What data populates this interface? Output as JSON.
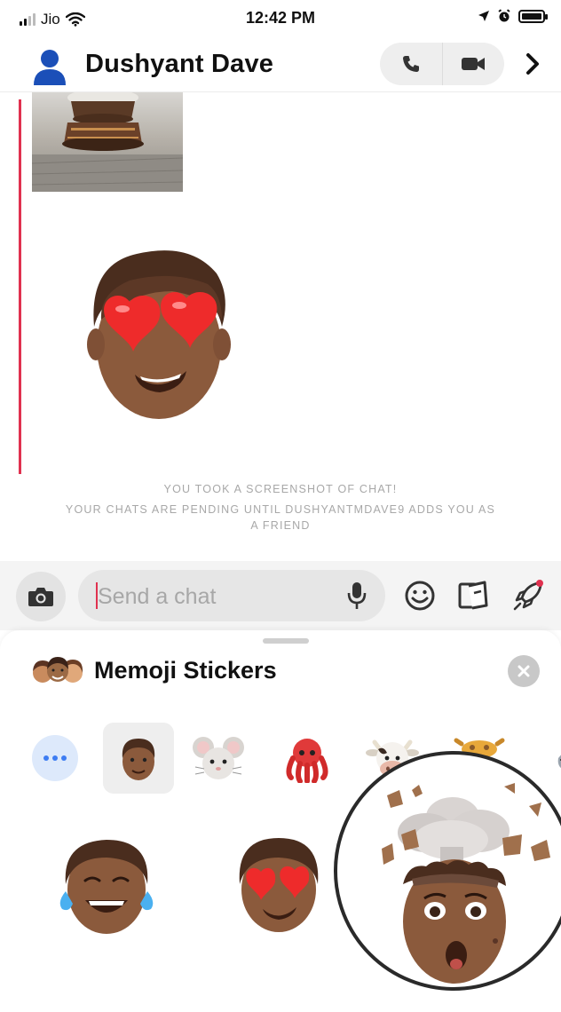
{
  "status_bar": {
    "carrier": "Jio",
    "time": "12:42 PM",
    "icons": [
      "signal-icon",
      "wifi-icon",
      "location-icon",
      "alarm-icon",
      "battery-icon"
    ]
  },
  "header": {
    "contact_name": "Dushyant Dave",
    "icons": [
      "avatar-icon",
      "phone-icon",
      "video-icon",
      "chevron-right-icon"
    ]
  },
  "chat": {
    "notice_line1": "YOU TOOK A SCREENSHOT OF CHAT!",
    "notice_line2": "YOUR CHATS ARE PENDING UNTIL DUSHYANTMDAVE9 ADDS YOU AS",
    "notice_line3": "A FRIEND",
    "accent_color": "#e0314f"
  },
  "input": {
    "placeholder": "Send a chat",
    "icons": [
      "camera-icon",
      "microphone-icon",
      "smiley-icon",
      "cards-icon",
      "rocket-icon"
    ]
  },
  "sticker_sheet": {
    "title": "Memoji Stickers",
    "categories": [
      "more",
      "memoji",
      "mouse",
      "octopus",
      "cow",
      "giraffe",
      "shark"
    ],
    "selected_category": "memoji",
    "stickers": [
      "tears-of-joy-memoji",
      "heart-eyes-memoji",
      "mind-blown-memoji"
    ]
  }
}
